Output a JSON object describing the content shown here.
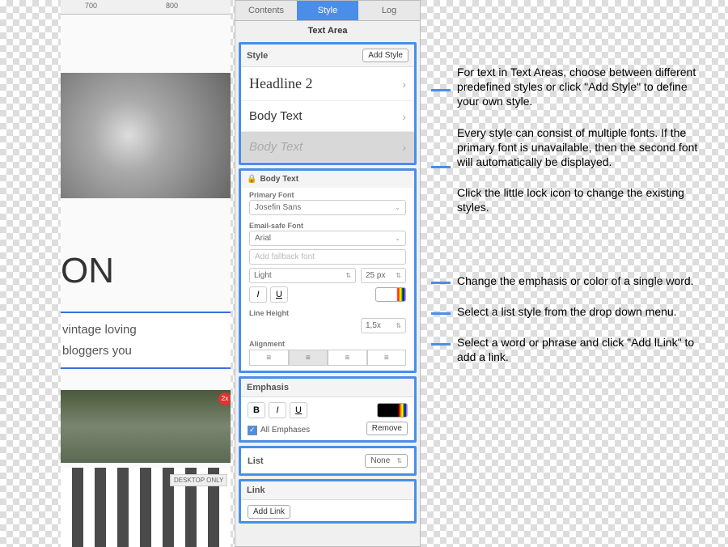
{
  "ruler": {
    "t1": "700",
    "t2": "800"
  },
  "canvas": {
    "title": "ON",
    "text1": "vintage loving",
    "text2": "bloggers you",
    "badge": "2x",
    "desktop_only": "DESKTOP ONLY"
  },
  "tabs": {
    "contents": "Contents",
    "style": "Style",
    "log": "Log"
  },
  "panel_title": "Text Area",
  "style_group": {
    "label": "Style",
    "add_style": "Add Style",
    "items": [
      "Headline 2",
      "Body Text",
      "Body Text"
    ]
  },
  "body_text": {
    "header": "Body Text",
    "primary_font_label": "Primary Font",
    "primary_font": "Josefin Sans",
    "email_safe_label": "Email-safe Font",
    "email_safe": "Arial",
    "fallback_placeholder": "Add fallback font",
    "weight": "Light",
    "size": "25 px",
    "italic": "I",
    "underline": "U",
    "line_height_label": "Line Height",
    "line_height": "1,5x",
    "alignment_label": "Alignment"
  },
  "emphasis": {
    "label": "Emphasis",
    "bold": "B",
    "italic": "I",
    "underline": "U",
    "all_emphases": "All Emphases",
    "remove": "Remove"
  },
  "list": {
    "label": "List",
    "value": "None"
  },
  "link": {
    "label": "Link",
    "add_link": "Add Link"
  },
  "annotations": {
    "a1": "For text in Text Areas, choose between different predefined styles or click \"Add Style\" to define your own style.",
    "a2": "Every style can consist of multiple fonts. If the primary font is unavailable, then the second font will automatically be displayed.",
    "a2b": "Click the little lock icon to change the existing styles.",
    "a3": "Change the emphasis or color of a single word.",
    "a4": "Select a list style from the drop down menu.",
    "a5": "Select a word or phrase and click \"Add lLink\" to add a link."
  }
}
